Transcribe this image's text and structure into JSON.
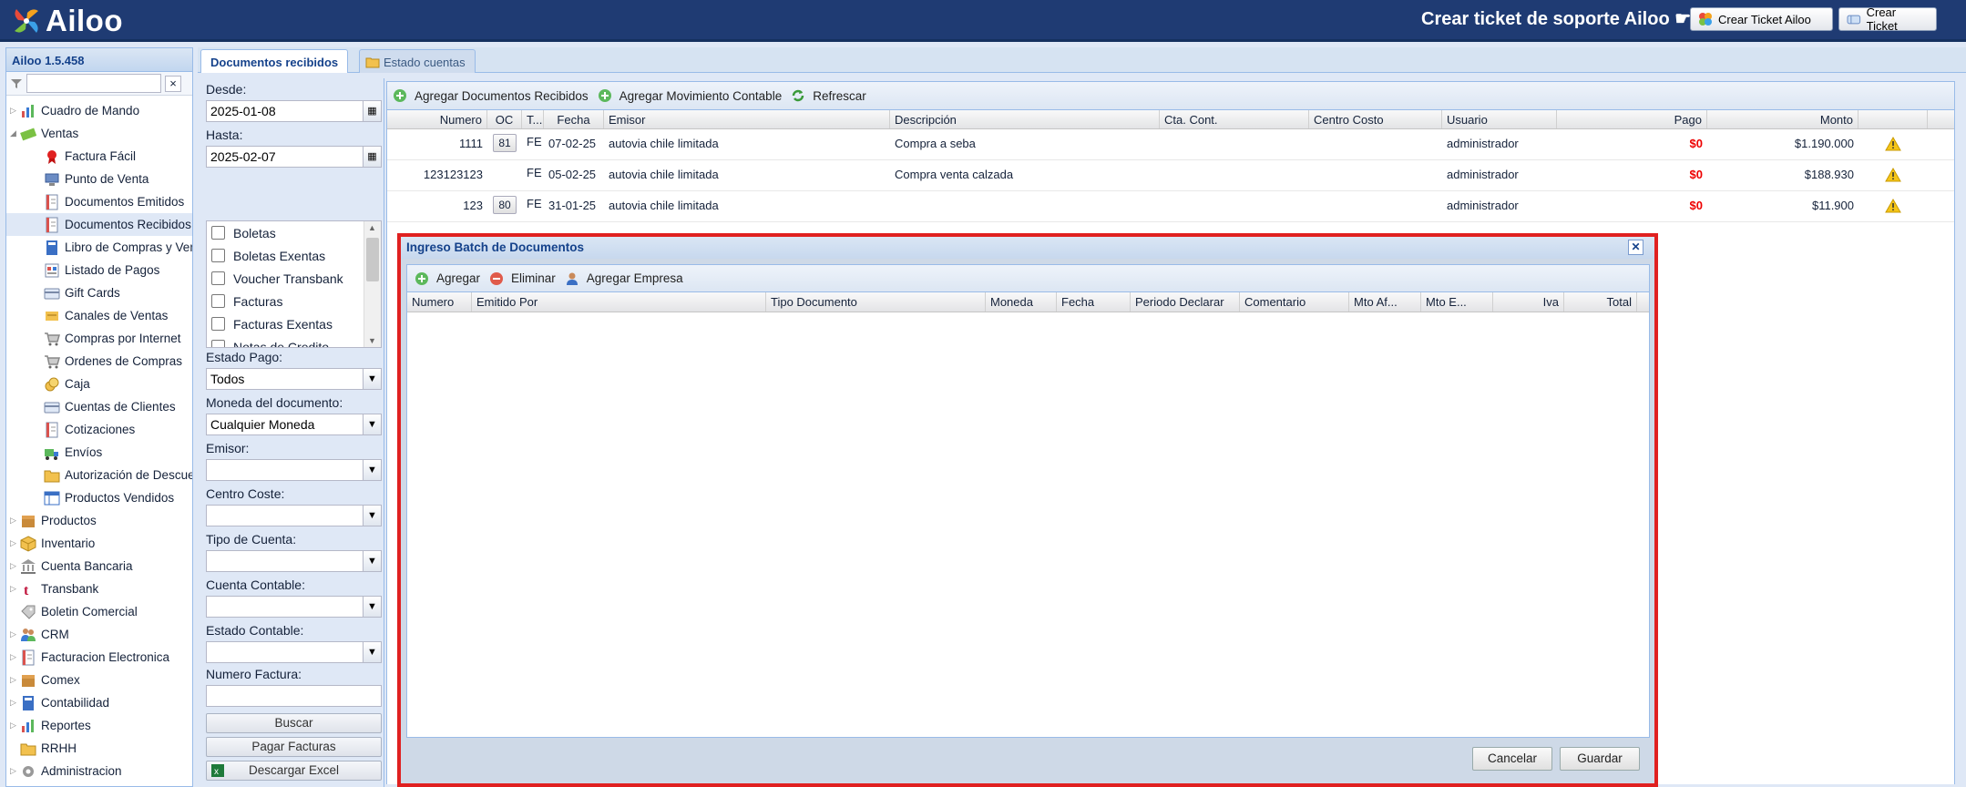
{
  "header": {
    "logo_text": "Ailoo",
    "support_title": "Crear ticket de soporte Ailoo ☛",
    "btn_crear_ticket_ailoo": "Crear Ticket Ailoo",
    "btn_crear_ticket": "Crear Ticket"
  },
  "sidebar": {
    "title": "Ailoo 1.5.458",
    "filter_value": "",
    "clear_label": "×",
    "items": [
      {
        "label": "Cuadro de Mando",
        "level": "top",
        "arrow": "▷",
        "icon": "chart-icon"
      },
      {
        "label": "Ventas",
        "level": "top",
        "arrow": "◢",
        "icon": "money-icon"
      },
      {
        "label": "Factura Fácil",
        "level": "sub",
        "icon": "ribbon-icon"
      },
      {
        "label": "Punto de Venta",
        "level": "sub",
        "icon": "computer-icon"
      },
      {
        "label": "Documentos Emitidos",
        "level": "sub",
        "icon": "document-icon"
      },
      {
        "label": "Documentos Recibidos",
        "level": "sub",
        "icon": "document-icon",
        "selected": true
      },
      {
        "label": "Libro de Compras y Ventas",
        "level": "sub",
        "icon": "book-icon"
      },
      {
        "label": "Listado de Pagos",
        "level": "sub",
        "icon": "list-icon"
      },
      {
        "label": "Gift Cards",
        "level": "sub",
        "icon": "card-icon"
      },
      {
        "label": "Canales de Ventas",
        "level": "sub",
        "icon": "channel-icon"
      },
      {
        "label": "Compras por Internet",
        "level": "sub",
        "icon": "cart-icon"
      },
      {
        "label": "Ordenes de Compras",
        "level": "sub",
        "icon": "cart-icon"
      },
      {
        "label": "Caja",
        "level": "sub",
        "icon": "coins-icon"
      },
      {
        "label": "Cuentas de Clientes",
        "level": "sub",
        "icon": "card-icon"
      },
      {
        "label": "Cotizaciones",
        "level": "sub",
        "icon": "document-icon"
      },
      {
        "label": "Envíos",
        "level": "sub",
        "icon": "truck-icon"
      },
      {
        "label": "Autorización de Descuentos",
        "level": "sub",
        "icon": "folder-icon"
      },
      {
        "label": "Productos Vendidos",
        "level": "sub",
        "icon": "table-icon"
      },
      {
        "label": "Productos",
        "level": "top",
        "arrow": "▷",
        "icon": "box-icon"
      },
      {
        "label": "Inventario",
        "level": "top",
        "arrow": "▷",
        "icon": "package-icon"
      },
      {
        "label": "Cuenta Bancaria",
        "level": "top",
        "arrow": "▷",
        "icon": "bank-icon"
      },
      {
        "label": "Transbank",
        "level": "top",
        "arrow": "▷",
        "icon": "transbank-icon"
      },
      {
        "label": "Boletin Comercial",
        "level": "top",
        "arrow": "",
        "icon": "tag-icon"
      },
      {
        "label": "CRM",
        "level": "top",
        "arrow": "▷",
        "icon": "users-icon"
      },
      {
        "label": "Facturacion Electronica",
        "level": "top",
        "arrow": "▷",
        "icon": "document-icon"
      },
      {
        "label": "Comex",
        "level": "top",
        "arrow": "▷",
        "icon": "box-icon"
      },
      {
        "label": "Contabilidad",
        "level": "top",
        "arrow": "▷",
        "icon": "book-icon"
      },
      {
        "label": "Reportes",
        "level": "top",
        "arrow": "▷",
        "icon": "chart-icon"
      },
      {
        "label": "RRHH",
        "level": "top",
        "arrow": "",
        "icon": "folder-icon"
      },
      {
        "label": "Administracion",
        "level": "top",
        "arrow": "▷",
        "icon": "gear-icon"
      }
    ]
  },
  "tabs": {
    "documentos_recibidos": "Documentos recibidos",
    "estado_cuentas": "Estado cuentas"
  },
  "filters": {
    "desde_label": "Desde:",
    "desde_value": "2025-01-08",
    "hasta_label": "Hasta:",
    "hasta_value": "2025-02-07",
    "doc_types": [
      "Boletas",
      "Boletas Exentas",
      "Voucher Transbank",
      "Facturas",
      "Facturas Exentas",
      "Notas de Credito"
    ],
    "estado_pago_label": "Estado Pago:",
    "estado_pago_value": "Todos",
    "moneda_label": "Moneda del documento:",
    "moneda_value": "Cualquier Moneda",
    "emisor_label": "Emisor:",
    "emisor_value": "",
    "centro_coste_label": "Centro Coste:",
    "centro_coste_value": "",
    "tipo_cuenta_label": "Tipo de Cuenta:",
    "tipo_cuenta_value": "",
    "cuenta_contable_label": "Cuenta Contable:",
    "cuenta_contable_value": "",
    "estado_contable_label": "Estado Contable:",
    "estado_contable_value": "",
    "numero_factura_label": "Numero Factura:",
    "numero_factura_value": "",
    "buscar": "Buscar",
    "pagar_facturas": "Pagar Facturas",
    "descargar_excel": "Descargar Excel"
  },
  "toolbar": {
    "agregar_documentos": "Agregar Documentos Recibidos",
    "agregar_movimiento": "Agregar Movimiento Contable",
    "refrescar": "Refrescar"
  },
  "grid": {
    "columns": [
      "Numero",
      "OC",
      "T...",
      "Fecha",
      "Emisor",
      "Descripción",
      "Cta. Cont.",
      "Centro Costo",
      "Usuario",
      "Pago",
      "Monto"
    ],
    "rows": [
      {
        "numero": "1111",
        "oc": "81",
        "tipo": "FE",
        "fecha": "07-02-25",
        "emisor": "autovia chile limitada",
        "descripcion": "Compra a seba",
        "cta": "",
        "centro": "",
        "usuario": "administrador",
        "pago": "$0",
        "monto": "$1.190.000"
      },
      {
        "numero": "123123123",
        "oc": "",
        "tipo": "FE",
        "fecha": "05-02-25",
        "emisor": "autovia chile limitada",
        "descripcion": "Compra venta calzada",
        "cta": "",
        "centro": "",
        "usuario": "administrador",
        "pago": "$0",
        "monto": "$188.930"
      },
      {
        "numero": "123",
        "oc": "80",
        "tipo": "FE",
        "fecha": "31-01-25",
        "emisor": "autovia chile limitada",
        "descripcion": "",
        "cta": "",
        "centro": "",
        "usuario": "administrador",
        "pago": "$0",
        "monto": "$11.900"
      }
    ]
  },
  "modal": {
    "title": "Ingreso Batch de Documentos",
    "close": "✕",
    "agregar": "Agregar",
    "eliminar": "Eliminar",
    "agregar_empresa": "Agregar Empresa",
    "columns": [
      "Numero",
      "Emitido Por",
      "Tipo Documento",
      "Moneda",
      "Fecha",
      "Periodo Declarar",
      "Comentario",
      "Mto Af...",
      "Mto E...",
      "Iva",
      "Total"
    ],
    "cancelar": "Cancelar",
    "guardar": "Guardar"
  },
  "colors": {
    "header_bg": "#1f3b73",
    "highlight_border": "#e02020",
    "pago_red": "#ee0000"
  }
}
